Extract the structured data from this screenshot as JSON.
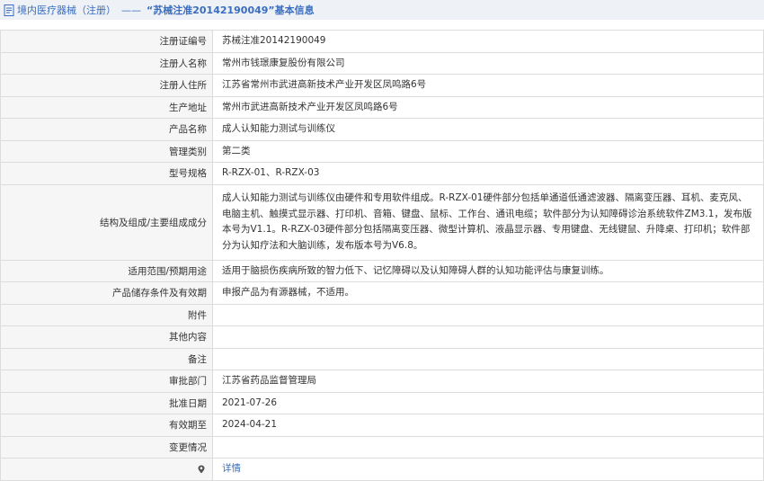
{
  "header": {
    "part1": "境内医疗器械（注册）",
    "separator": "——",
    "part2": "“苏械注准20142190049”基本信息"
  },
  "rows": [
    {
      "label": "注册证编号",
      "value": "苏械注准20142190049"
    },
    {
      "label": "注册人名称",
      "value": "常州市钱璟康复股份有限公司"
    },
    {
      "label": "注册人住所",
      "value": "江苏省常州市武进高新技术产业开发区凤鸣路6号"
    },
    {
      "label": "生产地址",
      "value": "常州市武进高新技术产业开发区凤鸣路6号"
    },
    {
      "label": "产品名称",
      "value": "成人认知能力测试与训练仪"
    },
    {
      "label": "管理类别",
      "value": "第二类"
    },
    {
      "label": "型号规格",
      "value": "R-RZX-01、R-RZX-03"
    },
    {
      "label": "结构及组成/主要组成成分",
      "value": "成人认知能力测试与训练仪由硬件和专用软件组成。R-RZX-01硬件部分包括单通道低通滤波器、隔离变压器、耳机、麦克风、电脑主机、触摸式显示器、打印机、音箱、键盘、鼠标、工作台、通讯电缆；软件部分为认知障碍诊治系统软件ZM3.1，发布版本号为V1.1。R-RZX-03硬件部分包括隔离变压器、微型计算机、液晶显示器、专用键盘、无线键鼠、升降桌、打印机；软件部分为认知疗法和大脑训练，发布版本号为V6.8。"
    },
    {
      "label": "适用范围/预期用途",
      "value": "适用于脑损伤疾病所致的智力低下、记忆障碍以及认知障碍人群的认知功能评估与康复训练。"
    },
    {
      "label": "产品储存条件及有效期",
      "value": "申报产品为有源器械，不适用。"
    },
    {
      "label": "附件",
      "value": ""
    },
    {
      "label": "其他内容",
      "value": ""
    },
    {
      "label": "备注",
      "value": ""
    },
    {
      "label": "审批部门",
      "value": "江苏省药品监督管理局"
    },
    {
      "label": "批准日期",
      "value": "2021-07-26"
    },
    {
      "label": "有效期至",
      "value": "2024-04-21"
    },
    {
      "label": "变更情况",
      "value": ""
    }
  ],
  "detail_link": "详情",
  "icons": {
    "header": "document-icon",
    "detail": "map-pin-icon"
  },
  "colors": {
    "accent": "#3a6dbf",
    "label_bg": "#f6f6f6",
    "header_bg": "#eef1f6"
  }
}
